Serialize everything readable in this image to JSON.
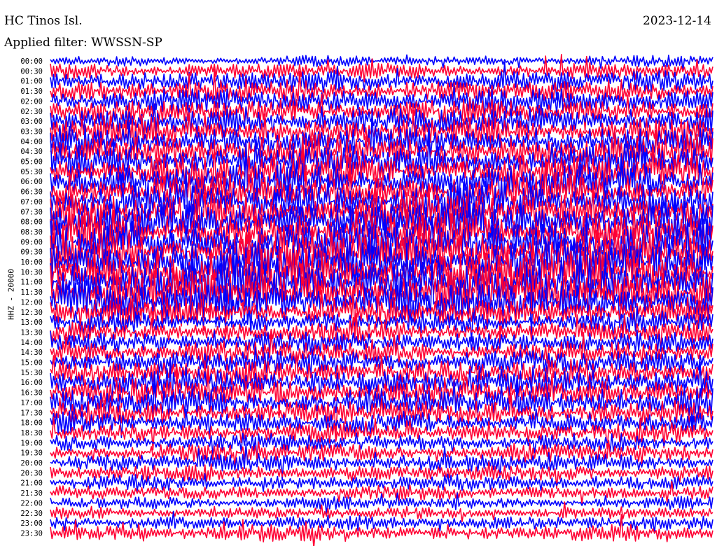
{
  "header": {
    "station": "HC Tinos Isl.",
    "date": "2023-12-14",
    "filter": "Applied filter: WWSSN-SP"
  },
  "chart_data": {
    "type": "line",
    "ylabel": "HHZ - 20000",
    "tick_labels": [
      "00:00",
      "00:30",
      "01:00",
      "01:30",
      "02:00",
      "02:30",
      "03:00",
      "03:30",
      "04:00",
      "04:30",
      "05:00",
      "05:30",
      "06:00",
      "06:30",
      "07:00",
      "07:30",
      "08:00",
      "08:30",
      "09:00",
      "09:30",
      "10:00",
      "10:30",
      "11:00",
      "11:30",
      "12:00",
      "12:30",
      "13:00",
      "13:30",
      "14:00",
      "14:30",
      "15:00",
      "15:30",
      "16:00",
      "16:30",
      "17:00",
      "17:30",
      "18:00",
      "18:30",
      "19:00",
      "19:30",
      "20:00",
      "20:30",
      "21:00",
      "21:30",
      "22:00",
      "22:30",
      "23:00",
      "23:30"
    ],
    "trace_colors": [
      "#0000ff",
      "#ff0033"
    ],
    "trace_amplitudes": [
      0.6,
      0.9,
      1.2,
      1.3,
      1.4,
      1.4,
      1.5,
      1.6,
      1.7,
      1.8,
      1.9,
      2.0,
      2.0,
      2.0,
      2.1,
      2.2,
      2.3,
      2.4,
      2.5,
      2.6,
      2.6,
      2.7,
      2.7,
      2.6,
      2.4,
      1.6,
      1.2,
      1.2,
      1.2,
      1.3,
      1.4,
      1.5,
      1.6,
      1.6,
      1.5,
      1.4,
      1.2,
      1.1,
      1.0,
      1.0,
      1.0,
      0.9,
      0.9,
      0.8,
      0.7,
      0.7,
      0.8,
      0.9
    ]
  }
}
